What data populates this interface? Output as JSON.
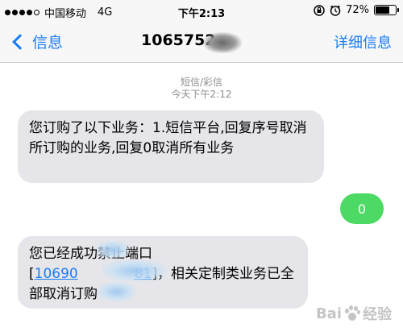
{
  "status_bar": {
    "carrier": "中国移动",
    "network": "4G",
    "time": "下午2:13",
    "battery_percent": "72%",
    "battery_level": 0.72,
    "icons": [
      "signal-dots-icon",
      "lock-rotation-icon",
      "alarm-icon",
      "battery-icon"
    ]
  },
  "nav": {
    "back_label": "信息",
    "title": "1065752",
    "details_label": "详细信息",
    "icons": [
      "chevron-left-icon"
    ]
  },
  "thread": {
    "message_type": "短信/彩信",
    "timestamp": "今天下午2:12"
  },
  "messages": [
    {
      "direction": "received",
      "text": "您订购了以下业务：1.短信平台,回复序号取消所订购的业务,回复0取消所有业务"
    },
    {
      "direction": "sent",
      "text": "0"
    },
    {
      "direction": "received",
      "text_before": "您已经成功禁止端口",
      "bracket_open": "[",
      "link_text": "10690",
      "link_tail": "81",
      "text_after": "]，相关定制类业务已全部取消订购"
    }
  ],
  "watermark": {
    "text": "Bai",
    "text2": "经验"
  },
  "colors": {
    "accent": "#1a7cf5",
    "received_bubble": "#e5e5ea",
    "sent_bubble": "#4cd964",
    "meta_text": "#8e8e93"
  }
}
